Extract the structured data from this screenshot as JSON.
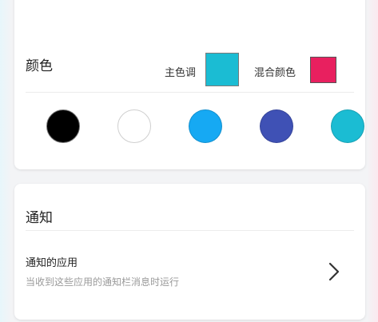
{
  "color_section": {
    "title": "颜色",
    "primary_label": "主色调",
    "primary_color": "#1bbcd3",
    "mix_label": "混合颜色",
    "mix_color": "#e8205f",
    "swatches": [
      {
        "name": "black",
        "color": "#000000"
      },
      {
        "name": "white",
        "color": "#ffffff"
      },
      {
        "name": "light-blue",
        "color": "#16a9f3"
      },
      {
        "name": "indigo",
        "color": "#3f51b5"
      },
      {
        "name": "cyan",
        "color": "#1bbcd3"
      }
    ]
  },
  "notification_section": {
    "title": "通知",
    "item_title": "通知的应用",
    "item_subtitle": "当收到这些应用的通知栏消息时运行",
    "item_icon": "chevron-right-icon"
  }
}
